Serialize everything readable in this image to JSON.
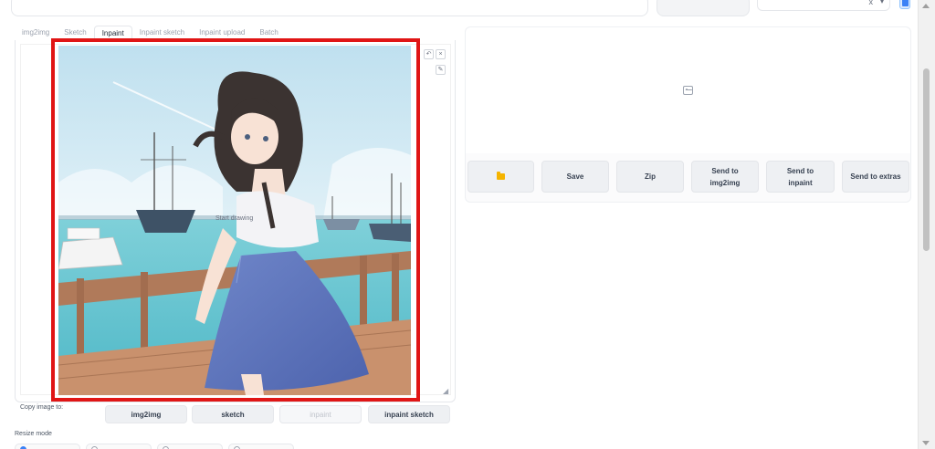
{
  "header": {
    "prompt_value": "",
    "style_select": {
      "clear_icon": "x",
      "chevron_icon": "chevron-down-icon"
    },
    "refresh_icon": "refresh-icon"
  },
  "tabs": [
    {
      "label": "img2img",
      "active": false
    },
    {
      "label": "Sketch",
      "active": false
    },
    {
      "label": "Inpaint",
      "active": true
    },
    {
      "label": "Inpaint sketch",
      "active": false
    },
    {
      "label": "Inpaint upload",
      "active": false
    },
    {
      "label": "Batch",
      "active": false
    }
  ],
  "canvas": {
    "hint": "Start drawing",
    "tools": {
      "undo_icon": "undo-icon",
      "clear_icon": "close-icon",
      "brush_icon": "brush-icon"
    },
    "highlight_color": "#e01515"
  },
  "copy_to": {
    "label": "Copy image to:",
    "buttons": [
      {
        "label": "img2img",
        "disabled": false
      },
      {
        "label": "sketch",
        "disabled": false
      },
      {
        "label": "inpaint",
        "disabled": true
      },
      {
        "label": "inpaint sketch",
        "disabled": false
      }
    ]
  },
  "resize": {
    "label": "Resize mode"
  },
  "output": {
    "empty_icon": "image-icon",
    "buttons": [
      {
        "label": "",
        "icon": "folder-icon"
      },
      {
        "label": "Save"
      },
      {
        "label": "Zip"
      },
      {
        "label": "Send to\nimg2img"
      },
      {
        "label": "Send to\ninpaint"
      },
      {
        "label": "Send to extras"
      }
    ]
  },
  "colors": {
    "accent": "#3b82f6",
    "highlight": "#e01515",
    "folder": "#f5b400"
  }
}
